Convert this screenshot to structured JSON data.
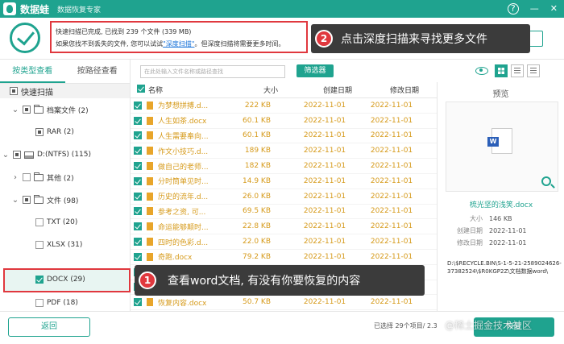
{
  "app": {
    "name": "数据蛙",
    "subtitle": "数据恢复专家",
    "brand_color": "#1fa38f",
    "accent_red": "#e0383e"
  },
  "window": {
    "help_icon": "?",
    "minimize": "—",
    "close": "✕"
  },
  "status": {
    "line1": "快速扫描已完成, 已找到 239 个文件 (339 MB)",
    "line2_before": "如果您找不到丢失的文件, 您可以试试",
    "deep_scan_link": "\"深度扫描\"",
    "line2_after": "。但深度扫描将需要更多时间。"
  },
  "callout2": {
    "badge": "2",
    "text": "点击深度扫描来寻找更多文件"
  },
  "callout1": {
    "badge": "1",
    "text": "查看word文档, 有没有你要恢复的内容"
  },
  "sidebar": {
    "tabs": [
      "按类型查看",
      "按路径查看"
    ],
    "tree_header": "快速扫描",
    "items": [
      {
        "label": "档案文件 (2)",
        "indent": 1
      },
      {
        "label": "RAR (2)",
        "indent": 2
      },
      {
        "label": "D:(NTFS) (115)",
        "indent": 0
      },
      {
        "label": "其他 (2)",
        "indent": 1
      },
      {
        "label": "文件 (98)",
        "indent": 1
      },
      {
        "label": "TXT (20)",
        "indent": 2
      },
      {
        "label": "XLSX (31)",
        "indent": 2
      },
      {
        "label": "DOCX (29)",
        "indent": 2
      },
      {
        "label": "PDF (18)",
        "indent": 2
      }
    ]
  },
  "toolbar": {
    "search_placeholder": "在此处输入文件名称或路径查找",
    "filter_label": "筛选器"
  },
  "list": {
    "columns": [
      "名称",
      "大小",
      "创建日期",
      "修改日期"
    ],
    "rows": [
      {
        "name": "为梦想拼搏.d...",
        "size": "222 KB",
        "created": "2022-11-01",
        "modified": "2022-11-01"
      },
      {
        "name": "人生如茶.docx",
        "size": "60.1 KB",
        "created": "2022-11-01",
        "modified": "2022-11-01"
      },
      {
        "name": "人生需要奉向...",
        "size": "60.1 KB",
        "created": "2022-11-01",
        "modified": "2022-11-01"
      },
      {
        "name": "作文小技巧.d...",
        "size": "189 KB",
        "created": "2022-11-01",
        "modified": "2022-11-01"
      },
      {
        "name": "做自己的老师...",
        "size": "182 KB",
        "created": "2022-11-01",
        "modified": "2022-11-01"
      },
      {
        "name": "分时筒单见时...",
        "size": "14.9 KB",
        "created": "2022-11-01",
        "modified": "2022-11-01"
      },
      {
        "name": "历史的流年.d...",
        "size": "26.0 KB",
        "created": "2022-11-01",
        "modified": "2022-11-01"
      },
      {
        "name": "参考之资, 可...",
        "size": "69.5 KB",
        "created": "2022-11-01",
        "modified": "2022-11-01"
      },
      {
        "name": "命运能够颠时...",
        "size": "22.8 KB",
        "created": "2022-11-01",
        "modified": "2022-11-01"
      },
      {
        "name": "四时的色彩.d...",
        "size": "22.0 KB",
        "created": "2022-11-01",
        "modified": "2022-11-01"
      },
      {
        "name": "奇跑.docx",
        "size": "79.2 KB",
        "created": "2022-11-01",
        "modified": "2022-11-01"
      },
      {
        "name": "",
        "size": "",
        "created": "",
        "modified": ""
      },
      {
        "name": "",
        "size": "",
        "created": "",
        "modified": ""
      },
      {
        "name": "恢复内容.docx",
        "size": "50.7 KB",
        "created": "2022-11-01",
        "modified": "2022-11-01"
      }
    ]
  },
  "preview": {
    "title": "预览",
    "file_name": "梳光坚的浅笑.docx",
    "size_label": "大小",
    "size_value": "146 KB",
    "created_label": "创建日期",
    "created_value": "2022-11-01",
    "modified_label": "修改日期",
    "modified_value": "2022-11-01",
    "path": "D:\\$RECYCLE.BIN\\S-1-5-21-2589024626-37382524\\$R0KGP2Z\\文档数据word\\"
  },
  "bottom": {
    "back_label": "返回",
    "selection_info": "已选择 29个项目/ 2.3",
    "recover_label": "恢复",
    "watermark": "@稀土掘金技术社区"
  }
}
